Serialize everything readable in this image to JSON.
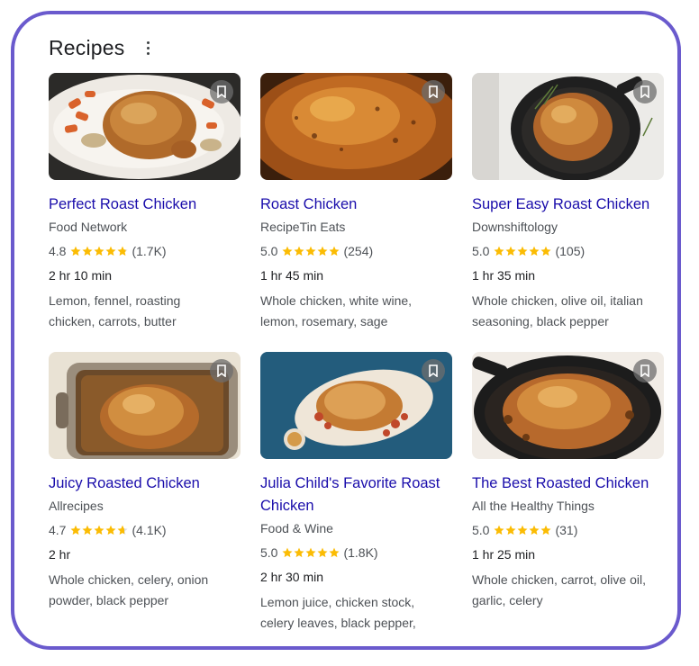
{
  "header": {
    "title": "Recipes",
    "more_icon": "more-vert-icon"
  },
  "colors": {
    "frame": "#6a5acd",
    "link": "#1a0dab",
    "star": "#fbbc04"
  },
  "recipes": [
    {
      "name": "Perfect Roast Chicken",
      "source": "Food Network",
      "rating": "4.8",
      "rating_value": 4.8,
      "reviews": "(1.7K)",
      "time": "2 hr 10 min",
      "ingredients": "Lemon, fennel, roasting chicken, carrots, butter",
      "image": "roast-chicken-on-white-plate-with-carrots"
    },
    {
      "name": "Roast Chicken",
      "source": "RecipeTin Eats",
      "rating": "5.0",
      "rating_value": 5.0,
      "reviews": "(254)",
      "time": "1 hr 45 min",
      "ingredients": "Whole chicken, white wine, lemon, rosemary, sage",
      "image": "close-up-roast-chicken-skin"
    },
    {
      "name": "Super Easy Roast Chicken",
      "source": "Downshiftology",
      "rating": "5.0",
      "rating_value": 5.0,
      "reviews": "(105)",
      "time": "1 hr 35 min",
      "ingredients": "Whole chicken, olive oil, italian seasoning, black pepper",
      "image": "roast-chicken-in-cast-iron-skillet-with-herbs"
    },
    {
      "name": "Juicy Roasted Chicken",
      "source": "Allrecipes",
      "rating": "4.7",
      "rating_value": 4.7,
      "reviews": "(4.1K)",
      "time": "2 hr",
      "ingredients": "Whole chicken, celery, onion powder, black pepper",
      "image": "roast-chicken-in-metal-roasting-pan"
    },
    {
      "name": "Julia Child's Favorite Roast Chicken",
      "source": "Food & Wine",
      "rating": "5.0",
      "rating_value": 5.0,
      "reviews": "(1.8K)",
      "time": "2 hr 30 min",
      "ingredients": "Lemon juice, chicken stock, celery leaves, black pepper,",
      "image": "roast-chicken-on-oval-platter-blue-background"
    },
    {
      "name": "The Best Roasted Chicken",
      "source": "All the Healthy Things",
      "rating": "5.0",
      "rating_value": 5.0,
      "reviews": "(31)",
      "time": "1 hr 25 min",
      "ingredients": "Whole chicken, carrot, olive oil, garlic, celery",
      "image": "roast-chicken-in-black-skillet"
    }
  ]
}
